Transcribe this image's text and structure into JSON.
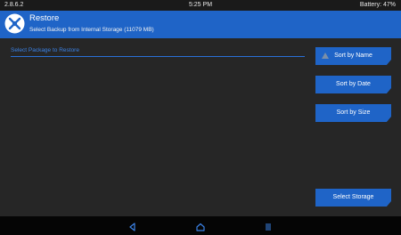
{
  "status": {
    "version": "2.8.6.2",
    "time": "5:25 PM",
    "battery": "Battery: 47%"
  },
  "header": {
    "title": "Restore",
    "subtitle": "Select Backup from Internal Storage (11079 MB)"
  },
  "list": {
    "header": "Select Package to Restore"
  },
  "buttons": {
    "sort_name": "Sort by Name",
    "sort_date": "Sort by Date",
    "sort_size": "Sort by Size",
    "select_storage": "Select Storage"
  },
  "icons": {
    "logo": "twrp-logo-icon",
    "sort_direction": "triangle-up-icon",
    "back": "back-icon",
    "home": "home-icon",
    "menu": "menu-icon"
  },
  "colors": {
    "accent": "#1f64c7",
    "background": "#262626",
    "highlight": "#3b82e6"
  }
}
